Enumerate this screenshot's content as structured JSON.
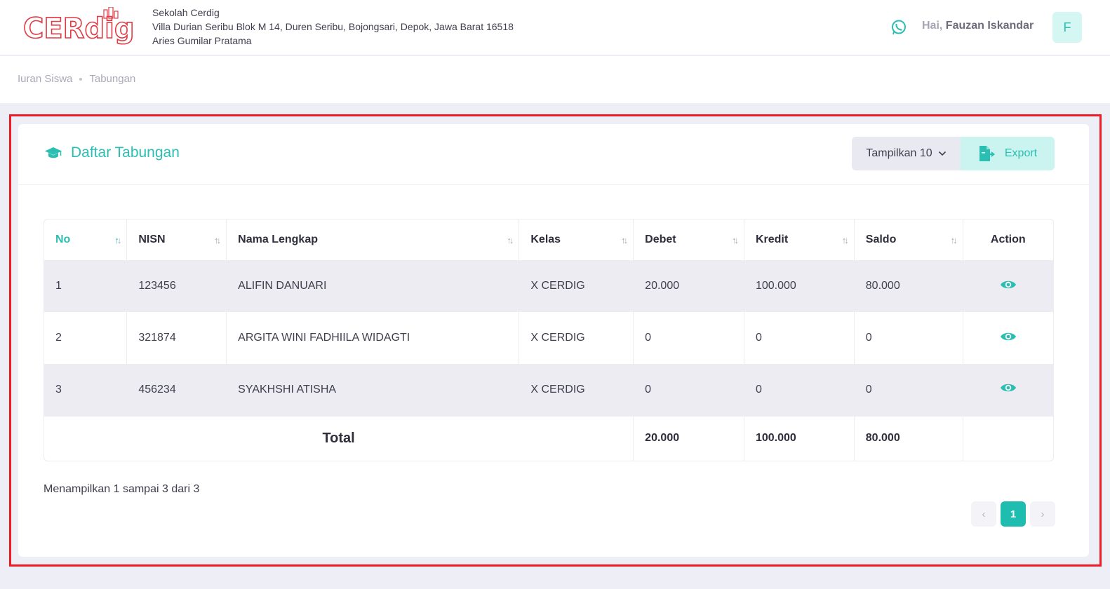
{
  "header": {
    "logo_text": "CERdig",
    "school_name": "Sekolah Cerdig",
    "school_address": "Villa Durian Seribu Blok M 14, Duren Seribu, Bojongsari, Depok, Jawa Barat 16518",
    "school_person": "Aries Gumilar Pratama",
    "greeting_prefix": "Hai,",
    "user_name": "Fauzan Iskandar",
    "avatar_letter": "F"
  },
  "breadcrumb": {
    "items": [
      "Iuran Siswa",
      "Tabungan"
    ]
  },
  "card": {
    "title": "Daftar Tabungan",
    "show_label": "Tampilkan 10",
    "export_label": "Export"
  },
  "table": {
    "columns": [
      "No",
      "NISN",
      "Nama Lengkap",
      "Kelas",
      "Debet",
      "Kredit",
      "Saldo",
      "Action"
    ],
    "rows": [
      {
        "no": "1",
        "nisn": "123456",
        "nama": "ALIFIN DANUARI",
        "kelas": "X CERDIG",
        "debet": "20.000",
        "kredit": "100.000",
        "saldo": "80.000"
      },
      {
        "no": "2",
        "nisn": "321874",
        "nama": "ARGITA WINI FADHIILA WIDAGTI",
        "kelas": "X CERDIG",
        "debet": "0",
        "kredit": "0",
        "saldo": "0"
      },
      {
        "no": "3",
        "nisn": "456234",
        "nama": "SYAKHSHI ATISHA",
        "kelas": "X CERDIG",
        "debet": "0",
        "kredit": "0",
        "saldo": "0"
      }
    ],
    "footer": {
      "label": "Total",
      "debet": "20.000",
      "kredit": "100.000",
      "saldo": "80.000"
    }
  },
  "pagination": {
    "info": "Menampilkan 1 sampai 3 dari 3",
    "prev": "‹",
    "current": "1",
    "next": "›"
  },
  "colors": {
    "accent": "#2bbfb3",
    "highlight_border": "#ef1c25",
    "logo_red": "#e03a44"
  },
  "icons": {
    "whatsapp": "whatsapp-icon",
    "title": "graduation-cap-icon",
    "export": "file-export-icon",
    "view": "eye-icon",
    "dropdown": "chevron-down-icon"
  }
}
